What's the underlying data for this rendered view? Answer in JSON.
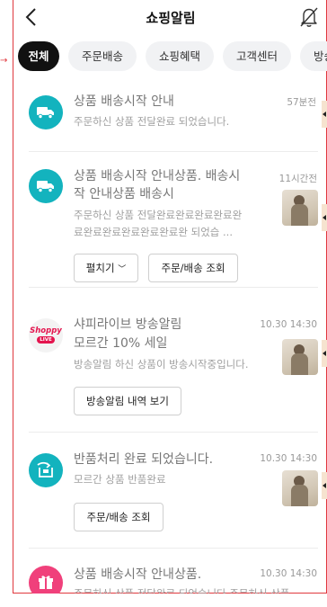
{
  "header": {
    "title": "쇼핑알림"
  },
  "tabs": [
    {
      "label": "전체",
      "active": true
    },
    {
      "label": "주문배송"
    },
    {
      "label": "쇼핑혜택"
    },
    {
      "label": "고객센터"
    },
    {
      "label": "방송알림"
    }
  ],
  "notifications": [
    {
      "icon": "truck-icon",
      "title": "상품 배송시작 안내",
      "body": "주문하신 상품 전달완료 되었습니다.",
      "time": "57분전"
    },
    {
      "icon": "truck-icon",
      "title_line1": "상품 배송시작 안내상품.   배송시",
      "title_line2": "작 안내상품 배송시",
      "body_line1": "주문하신 상품 전달완료완료완료완료완",
      "body_line2": "료완료완료완료완료완료완 되었습 ...",
      "time": "11시간전",
      "buttons": {
        "expand": "펼치기",
        "order": "주문/배송 조회"
      }
    },
    {
      "icon": "shoppy-live-icon",
      "brand_text": "Shoppy",
      "brand_badge": "LIVE",
      "title_line1": "샤피라이브 방송알림",
      "title_line2": "모르간 10% 세일",
      "body": "방송알림 하신 상품이 방송시작중입니다.",
      "time": "10.30 14:30",
      "buttons": {
        "history": "방송알림 내역 보기"
      }
    },
    {
      "icon": "return-icon",
      "title": "반품처리 완료 되었습니다.",
      "body": "모르간 상품 반품완료",
      "time": "10.30 14:30",
      "buttons": {
        "order": "주문/배송 조회"
      }
    },
    {
      "icon": "gift-icon",
      "title": "상품 배송시작 안내상품.",
      "body": "주문하신 상품 전달완료 되었습니다.주문하신 상품",
      "time": "10.30 14:30"
    }
  ],
  "colors": {
    "teal": "#13b3be",
    "pink": "#f0407b",
    "frame": "#e0383e",
    "active_tab": "#111111"
  }
}
